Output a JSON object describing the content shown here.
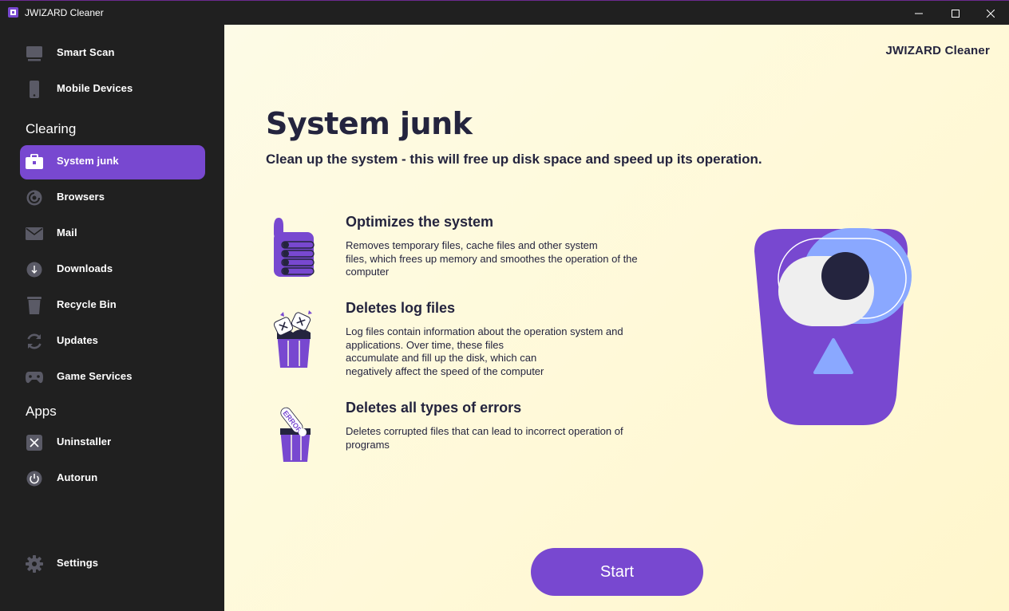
{
  "window": {
    "title": "JWIZARD Cleaner"
  },
  "sidebar": {
    "top_items": [
      {
        "label": "Smart Scan",
        "icon": "monitor-icon"
      },
      {
        "label": "Mobile Devices",
        "icon": "phone-icon"
      }
    ],
    "sections": [
      {
        "title": "Clearing"
      },
      {
        "title": "Apps"
      }
    ],
    "clearing_items": [
      {
        "label": "System junk",
        "icon": "briefcase-icon",
        "active": true
      },
      {
        "label": "Browsers",
        "icon": "browser-icon"
      },
      {
        "label": "Mail",
        "icon": "mail-icon"
      },
      {
        "label": "Downloads",
        "icon": "download-icon"
      },
      {
        "label": "Recycle Bin",
        "icon": "trash-icon"
      },
      {
        "label": "Updates",
        "icon": "refresh-icon"
      },
      {
        "label": "Game Services",
        "icon": "gamepad-icon"
      }
    ],
    "apps_items": [
      {
        "label": "Uninstaller",
        "icon": "close-box-icon"
      },
      {
        "label": "Autorun",
        "icon": "power-icon"
      }
    ],
    "settings": {
      "label": "Settings",
      "icon": "gear-icon"
    }
  },
  "main": {
    "brand": "JWIZARD Cleaner",
    "title": "System junk",
    "subtitle": "Clean up the system - this will free up disk space and speed up its operation.",
    "features": [
      {
        "title": "Optimizes the system",
        "desc": "Removes temporary files, cache files and other system\nfiles, which frees up memory and smoothes the operation of the\ncomputer",
        "icon": "thumbs-up-icon"
      },
      {
        "title": "Deletes log files",
        "desc": "Log files contain information about the operation system and\napplications. Over time, these files\naccumulate and fill up the disk, which can\nnegatively affect the speed of the computer",
        "icon": "trash-logs-icon"
      },
      {
        "title": "Deletes all types of errors",
        "desc": "Deletes corrupted files that can lead to incorrect operation of\nprograms",
        "icon": "trash-error-icon",
        "icon_text": "ERROR"
      }
    ],
    "start_label": "Start"
  },
  "colors": {
    "accent": "#7848d0",
    "sidebar_bg": "#202020",
    "text_dark": "#24243e",
    "light_blue": "#8aa8ff"
  }
}
